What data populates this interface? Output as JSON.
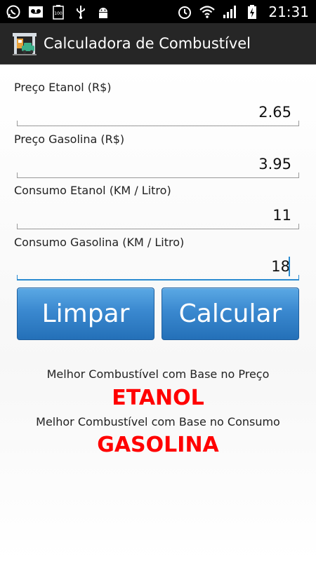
{
  "status_bar": {
    "time": "21:31",
    "left_icons": [
      "whatsapp-icon",
      "voicemail-icon",
      "battery-100-icon",
      "usb-icon",
      "android-debug-icon"
    ],
    "right_icons": [
      "alarm-icon",
      "wifi-icon",
      "signal-icon",
      "battery-charging-icon"
    ],
    "battery_small_label": "100"
  },
  "action_bar": {
    "title": "Calculadora de Combustível",
    "icon": "gas-station-app-icon"
  },
  "form": {
    "preco_etanol": {
      "label": "Preço Etanol (R$)",
      "value": "2.65"
    },
    "preco_gasolina": {
      "label": "Preço Gasolina (R$)",
      "value": "3.95"
    },
    "consumo_etanol": {
      "label": "Consumo Etanol (KM / Litro)",
      "value": "11"
    },
    "consumo_gasolina": {
      "label": "Consumo Gasolina (KM / Litro)",
      "value": "18"
    }
  },
  "buttons": {
    "limpar": "Limpar",
    "calcular": "Calcular"
  },
  "results": {
    "preco_label": "Melhor Combustível com Base no Preço",
    "preco_value": "ETANOL",
    "consumo_label": "Melhor Combustível com Base no Consumo",
    "consumo_value": "GASOLINA"
  },
  "colors": {
    "accent": "#2a8bd1",
    "result_red": "#ff0000",
    "action_bar": "#262626",
    "button_blue": "#3a88cf"
  }
}
